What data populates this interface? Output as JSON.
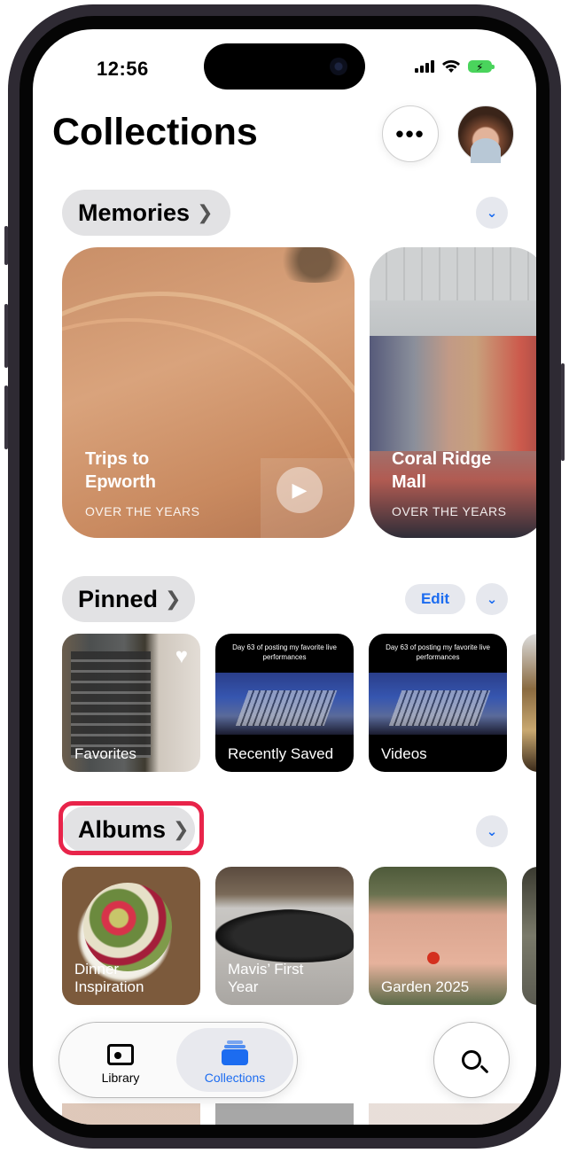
{
  "status_bar": {
    "time": "12:56"
  },
  "header": {
    "title": "Collections",
    "more_label": "•••"
  },
  "memories": {
    "section_label": "Memories",
    "items": [
      {
        "title": "Trips to Epworth",
        "subtitle": "OVER THE YEARS"
      },
      {
        "title": "Coral Ridge Mall",
        "subtitle": "OVER THE YEARS"
      }
    ]
  },
  "pinned": {
    "section_label": "Pinned",
    "edit_label": "Edit",
    "items": [
      {
        "label": "Favorites"
      },
      {
        "label": "Recently Saved",
        "overlay_text": "Day 63 of posting my favorite live performances"
      },
      {
        "label": "Videos",
        "overlay_text": "Day 63 of posting my favorite live performances"
      }
    ]
  },
  "albums": {
    "section_label": "Albums",
    "items": [
      {
        "label": "Dinner Inspiration"
      },
      {
        "label": "Mavis’ First Year"
      },
      {
        "label": "Garden 2025"
      }
    ]
  },
  "tabbar": {
    "tabs": [
      {
        "label": "Library",
        "icon": "photo-library-icon"
      },
      {
        "label": "Collections",
        "icon": "collections-icon",
        "selected": true
      }
    ],
    "search_icon": "search-icon"
  },
  "colors": {
    "accent": "#1c6cf0",
    "highlight": "#e8244a"
  }
}
